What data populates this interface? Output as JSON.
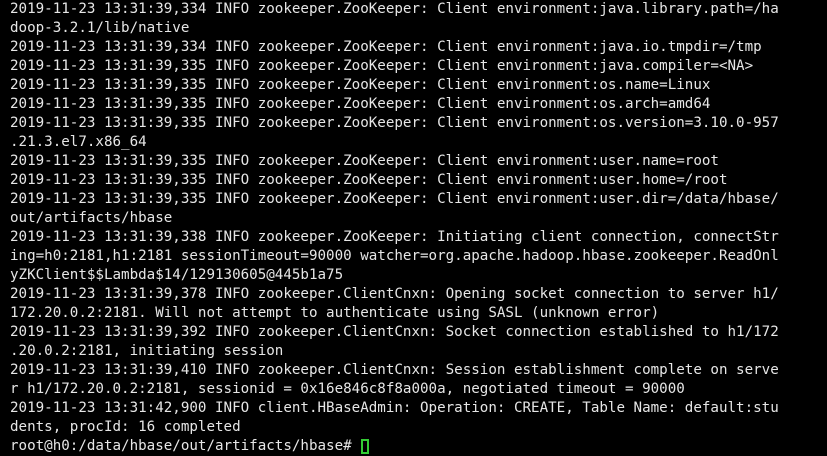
{
  "terminal": {
    "lines": [
      "2019-11-23 13:31:39,334 INFO zookeeper.ZooKeeper: Client environment:java.library.path=/ha",
      "doop-3.2.1/lib/native",
      "2019-11-23 13:31:39,334 INFO zookeeper.ZooKeeper: Client environment:java.io.tmpdir=/tmp",
      "2019-11-23 13:31:39,335 INFO zookeeper.ZooKeeper: Client environment:java.compiler=<NA>",
      "2019-11-23 13:31:39,335 INFO zookeeper.ZooKeeper: Client environment:os.name=Linux",
      "2019-11-23 13:31:39,335 INFO zookeeper.ZooKeeper: Client environment:os.arch=amd64",
      "2019-11-23 13:31:39,335 INFO zookeeper.ZooKeeper: Client environment:os.version=3.10.0-957",
      ".21.3.el7.x86_64",
      "2019-11-23 13:31:39,335 INFO zookeeper.ZooKeeper: Client environment:user.name=root",
      "2019-11-23 13:31:39,335 INFO zookeeper.ZooKeeper: Client environment:user.home=/root",
      "2019-11-23 13:31:39,335 INFO zookeeper.ZooKeeper: Client environment:user.dir=/data/hbase/",
      "out/artifacts/hbase",
      "2019-11-23 13:31:39,338 INFO zookeeper.ZooKeeper: Initiating client connection, connectStr",
      "ing=h0:2181,h1:2181 sessionTimeout=90000 watcher=org.apache.hadoop.hbase.zookeeper.ReadOnl",
      "yZKClient$$Lambda$14/129130605@445b1a75",
      "2019-11-23 13:31:39,378 INFO zookeeper.ClientCnxn: Opening socket connection to server h1/",
      "172.20.0.2:2181. Will not attempt to authenticate using SASL (unknown error)",
      "2019-11-23 13:31:39,392 INFO zookeeper.ClientCnxn: Socket connection established to h1/172",
      ".20.0.2:2181, initiating session",
      "2019-11-23 13:31:39,410 INFO zookeeper.ClientCnxn: Session establishment complete on serve",
      "r h1/172.20.0.2:2181, sessionid = 0x16e846c8f8a000a, negotiated timeout = 90000",
      "2019-11-23 13:31:42,900 INFO client.HBaseAdmin: Operation: CREATE, Table Name: default:stu",
      "dents, procId: 16 completed"
    ],
    "prompt": "root@h0:/data/hbase/out/artifacts/hbase# ",
    "colors": {
      "background": "#000000",
      "foreground": "#e6e6e6",
      "cursor": "#33cc33"
    }
  }
}
